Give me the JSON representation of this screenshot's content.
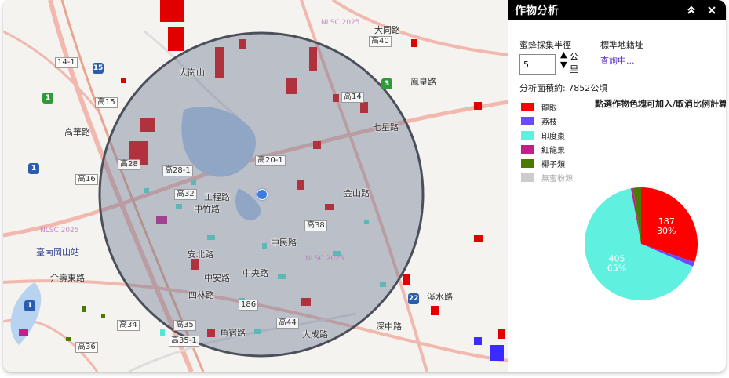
{
  "panel": {
    "title": "作物分析",
    "collapse_glyph": "︽",
    "close_glyph": "✕",
    "radius_label": "蜜蜂採集半徑",
    "radius_value": "5",
    "radius_unit": "公里",
    "address_label": "標準地籍址",
    "address_link": "查詢中...",
    "area_text": "分析面積約: 7852公頃",
    "hint": "點選作物色塊可加入/取消比例計算"
  },
  "legend": [
    {
      "label": "龍眼",
      "color": "#ff0000",
      "enabled": true
    },
    {
      "label": "荔枝",
      "color": "#6a4cff",
      "enabled": true
    },
    {
      "label": "印度棗",
      "color": "#5ff0e0",
      "enabled": true
    },
    {
      "label": "紅龍果",
      "color": "#c21f8c",
      "enabled": true
    },
    {
      "label": "椰子類",
      "color": "#4a7a00",
      "enabled": true
    },
    {
      "label": "無蜜粉源",
      "color": "#cccccc",
      "enabled": false
    }
  ],
  "chart_data": {
    "type": "pie",
    "slices": [
      {
        "name": "龍眼",
        "value": 187,
        "label": "187",
        "pct_label": "30%",
        "color": "#ff0000"
      },
      {
        "name": "荔枝",
        "value": 8,
        "color": "#6a4cff"
      },
      {
        "name": "印度棗",
        "value": 405,
        "label": "405",
        "pct_label": "65%",
        "color": "#5ff0e0"
      },
      {
        "name": "紅龍果",
        "value": 4,
        "color": "#c21f8c"
      },
      {
        "name": "椰子類",
        "value": 14,
        "color": "#4a7a00"
      }
    ]
  },
  "map": {
    "roads": [
      "高15",
      "高14",
      "高20-1",
      "高28",
      "高28-1",
      "高32",
      "高38",
      "高44",
      "高35",
      "高35-1",
      "高34",
      "高36",
      "高40",
      "高16",
      "186",
      "14-1"
    ],
    "places": [
      "大崗山",
      "七星路",
      "工程路",
      "中竹路",
      "中民路",
      "安北路",
      "中安路",
      "四林路",
      "大成路",
      "深中路",
      "溪水路",
      "大同路",
      "金山路",
      "鳳皇路",
      "介壽東路",
      "高華路",
      "中央路",
      "角宿路"
    ],
    "station": "臺南岡山站",
    "watermarks": [
      "NLSC 2025",
      "NLSC 2025",
      "NLSC 2025"
    ],
    "shields": [
      "1",
      "3",
      "22",
      "1",
      "15",
      "1"
    ]
  }
}
